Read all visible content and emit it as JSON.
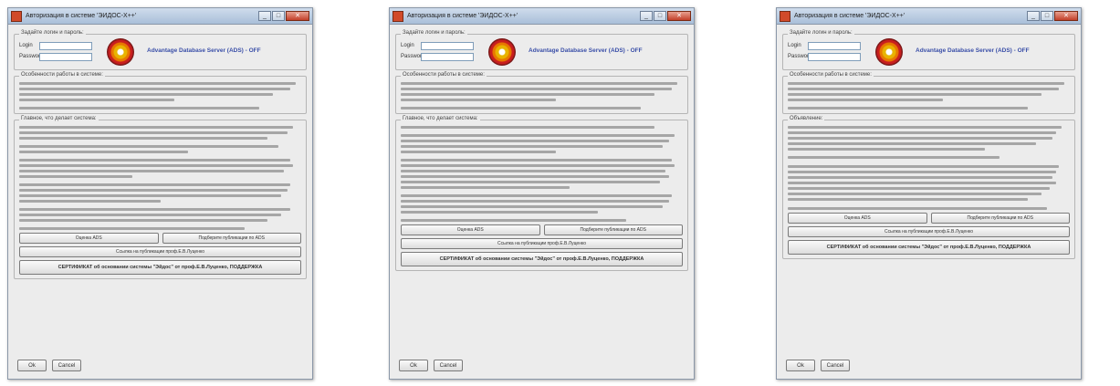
{
  "windows": [
    {
      "title": "Авторизация в системе 'ЭЙДОС-Х++'",
      "variant": "A",
      "login_group_label": "Задайте логин и пароль:",
      "login_label": "Login",
      "password_label": "Password",
      "brand": "Advantage Database Server (ADS) - OFF",
      "section1_label": "Особенности работы в системе:",
      "section2_label": "Главное, что делает система:",
      "btn_install": "Оценка ADS",
      "btn_read": "Подберите публикации по ADS",
      "btn_ref": "Ссылка на публикации проф.Е.В.Луценко",
      "btn_cert": "СЕРТИФИКАТ об основании системы \"Эйдос\" от проф.Е.В.Луценко, ПОДДЕРЖКА",
      "ok": "Ok",
      "cancel": "Cancel"
    },
    {
      "title": "Авторизация в системе 'ЭЙДОС-Х++'",
      "variant": "B",
      "login_group_label": "Задайте логин и пароль:",
      "login_label": "Login",
      "password_label": "Password",
      "brand": "Advantage Database Server (ADS) - OFF",
      "section1_label": "Особенности работы в системе:",
      "section2_label": "Главное, что делает система:",
      "btn_install": "Оценка ADS",
      "btn_read": "Подберите публикации по ADS",
      "btn_ref": "Ссылка на публикации проф.Е.В.Луценко",
      "btn_cert": "СЕРТИФИКАТ об основании системы \"Эйдос\" от проф.Е.В.Луценко, ПОДДЕРЖКА",
      "ok": "Ok",
      "cancel": "Cancel"
    },
    {
      "title": "Авторизация в системе 'ЭЙДОС-Х++'",
      "variant": "C",
      "login_group_label": "Задайте логин и пароль:",
      "login_label": "Login",
      "password_label": "Password",
      "brand": "Advantage Database Server (ADS) - OFF",
      "section1_label": "Особенности работы в системе:",
      "section2_label": "Объявление:",
      "btn_install": "Оценка ADS",
      "btn_read": "Подберите публикации по ADS",
      "btn_ref": "Ссылка на публикации проф.Е.В.Луценко",
      "btn_cert": "СЕРТИФИКАТ об основании системы \"Эйдос\" от проф.Е.В.Луценко, ПОДДЕРЖКА",
      "ok": "Ok",
      "cancel": "Cancel"
    }
  ],
  "login_value": "",
  "password_value": "",
  "colors": {
    "brand": "#3a4fa8",
    "window_bg": "#ececec",
    "titlebar": "#a9bfd9"
  }
}
